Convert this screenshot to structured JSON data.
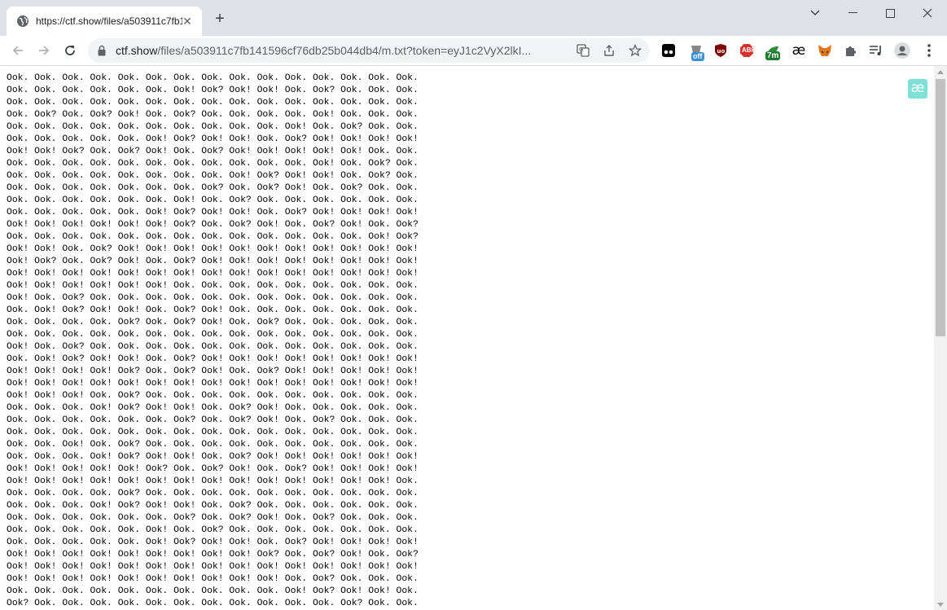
{
  "tab": {
    "title": "https://ctf.show/files/a503911c7fb141596cf76db25b044db4/m.txt?token=eyJ1c2VyX2lkI"
  },
  "omnibox": {
    "host": "ctf.show",
    "path": "/files/a503911c7fb141596cf76db25b044db4/m.txt?token=eyJ1c2VyX2lkI..."
  },
  "extensions": {
    "off_badge": "off",
    "abp_label": "ABP",
    "timer_badge": "7m",
    "ae_label": "æ"
  },
  "page": {
    "ae_button": "æ",
    "ook_lines": [
      "Ook. Ook. Ook. Ook. Ook. Ook. Ook. Ook. Ook. Ook. Ook. Ook. Ook. Ook. Ook.",
      "Ook. Ook. Ook. Ook. Ook. Ook. Ook! Ook? Ook! Ook! Ook. Ook? Ook. Ook. Ook.",
      "Ook. Ook. Ook. Ook. Ook. Ook. Ook. Ook. Ook. Ook. Ook. Ook. Ook. Ook. Ook.",
      "Ook. Ook? Ook. Ook? Ook! Ook. Ook? Ook. Ook. Ook. Ook. Ook! Ook. Ook. Ook.",
      "Ook. Ook. Ook. Ook. Ook. Ook. Ook. Ook. Ook. Ook. Ook! Ook. Ook? Ook. Ook.",
      "Ook. Ook. Ook. Ook. Ook. Ook! Ook? Ook! Ook! Ook. Ook? Ook! Ook! Ook! Ook!",
      "Ook! Ook! Ook? Ook. Ook? Ook! Ook. Ook? Ook! Ook! Ook! Ook! Ook! Ook. Ook.",
      "Ook. Ook. Ook. Ook. Ook. Ook. Ook. Ook. Ook. Ook. Ook. Ook! Ook. Ook? Ook.",
      "Ook. Ook. Ook. Ook. Ook. Ook. Ook. Ook. Ook! Ook? Ook! Ook! Ook. Ook? Ook.",
      "Ook. Ook. Ook. Ook. Ook. Ook. Ook. Ook? Ook. Ook? Ook! Ook. Ook? Ook. Ook.",
      "Ook. Ook. Ook. Ook. Ook. Ook. Ook! Ook. Ook? Ook. Ook. Ook. Ook. Ook. Ook.",
      "Ook. Ook. Ook. Ook. Ook. Ook! Ook? Ook! Ook! Ook. Ook? Ook! Ook! Ook! Ook!",
      "Ook! Ook! Ook! Ook! Ook! Ook! Ook? Ook. Ook? Ook! Ook. Ook? Ook! Ook. Ook?",
      "Ook. Ook. Ook. Ook. Ook. Ook. Ook. Ook. Ook. Ook. Ook. Ook. Ook. Ook! Ook?",
      "Ook! Ook! Ook. Ook? Ook! Ook! Ook! Ook! Ook! Ook! Ook! Ook! Ook! Ook! Ook!",
      "Ook! Ook? Ook. Ook? Ook! Ook. Ook? Ook! Ook! Ook! Ook! Ook! Ook! Ook! Ook!",
      "Ook! Ook! Ook! Ook! Ook! Ook! Ook! Ook! Ook! Ook! Ook! Ook! Ook! Ook! Ook!",
      "Ook! Ook! Ook! Ook! Ook! Ook! Ook. Ook. Ook. Ook. Ook. Ook. Ook. Ook. Ook.",
      "Ook! Ook. Ook? Ook. Ook. Ook. Ook. Ook. Ook. Ook. Ook. Ook. Ook. Ook. Ook.",
      "Ook. Ook! Ook? Ook! Ook! Ook. Ook? Ook! Ook. Ook. Ook. Ook. Ook. Ook. Ook.",
      "Ook. Ook. Ook. Ook. Ook? Ook. Ook? Ook! Ook. Ook? Ook. Ook. Ook. Ook. Ook.",
      "Ook. Ook. Ook. Ook. Ook. Ook. Ook. Ook. Ook. Ook. Ook. Ook. Ook. Ook. Ook.",
      "Ook! Ook. Ook? Ook. Ook. Ook. Ook. Ook. Ook. Ook. Ook. Ook. Ook. Ook. Ook.",
      "Ook. Ook! Ook? Ook! Ook! Ook. Ook? Ook! Ook! Ook! Ook! Ook! Ook! Ook! Ook!",
      "Ook! Ook! Ook! Ook! Ook? Ook. Ook? Ook! Ook. Ook? Ook! Ook! Ook! Ook! Ook!",
      "Ook! Ook! Ook! Ook! Ook! Ook! Ook! Ook! Ook! Ook! Ook! Ook! Ook! Ook! Ook!",
      "Ook! Ook! Ook! Ook. Ook? Ook. Ook. Ook. Ook. Ook. Ook. Ook. Ook. Ook. Ook.",
      "Ook. Ook. Ook. Ook! Ook? Ook! Ook! Ook. Ook? Ook! Ook. Ook. Ook. Ook. Ook.",
      "Ook. Ook. Ook. Ook. Ook. Ook. Ook? Ook. Ook? Ook! Ook. Ook? Ook. Ook. Ook.",
      "Ook. Ook. Ook. Ook. Ook. Ook. Ook. Ook. Ook. Ook. Ook. Ook. Ook. Ook. Ook.",
      "Ook. Ook. Ook! Ook. Ook? Ook. Ook. Ook. Ook. Ook. Ook. Ook. Ook. Ook. Ook.",
      "Ook. Ook. Ook. Ook! Ook? Ook! Ook! Ook. Ook? Ook! Ook! Ook! Ook! Ook! Ook!",
      "Ook! Ook! Ook! Ook! Ook! Ook? Ook. Ook? Ook! Ook. Ook? Ook! Ook! Ook! Ook!",
      "Ook! Ook! Ook! Ook! Ook! Ook! Ook! Ook! Ook! Ook! Ook! Ook! Ook! Ook! Ook.",
      "Ook. Ook. Ook. Ook. Ook? Ook. Ook. Ook. Ook. Ook. Ook. Ook. Ook. Ook. Ook.",
      "Ook. Ook. Ook. Ook! Ook? Ook! Ook! Ook. Ook? Ook. Ook. Ook. Ook. Ook. Ook.",
      "Ook. Ook. Ook. Ook. Ook. Ook. Ook? Ook. Ook? Ook! Ook. Ook? Ook. Ook. Ook.",
      "Ook. Ook. Ook. Ook. Ook. Ook! Ook. Ook? Ook. Ook. Ook. Ook. Ook. Ook. Ook.",
      "Ook. Ook. Ook. Ook. Ook. Ook! Ook? Ook! Ook! Ook. Ook? Ook! Ook! Ook! Ook!",
      "Ook! Ook! Ook! Ook! Ook! Ook! Ook! Ook! Ook! Ook? Ook. Ook? Ook! Ook. Ook?",
      "Ook! Ook! Ook! Ook! Ook! Ook! Ook! Ook! Ook! Ook! Ook! Ook! Ook! Ook! Ook!",
      "Ook! Ook! Ook! Ook! Ook! Ook! Ook! Ook! Ook! Ook! Ook. Ook? Ook. Ook. Ook.",
      "Ook. Ook. Ook. Ook. Ook. Ook. Ook. Ook. Ook. Ook. Ook! Ook? Ook! Ook! Ook.",
      "Ook? Ook. Ook. Ook. Ook. Ook. Ook. Ook. Ook. Ook. Ook. Ook. Ook? Ook. Ook."
    ]
  }
}
